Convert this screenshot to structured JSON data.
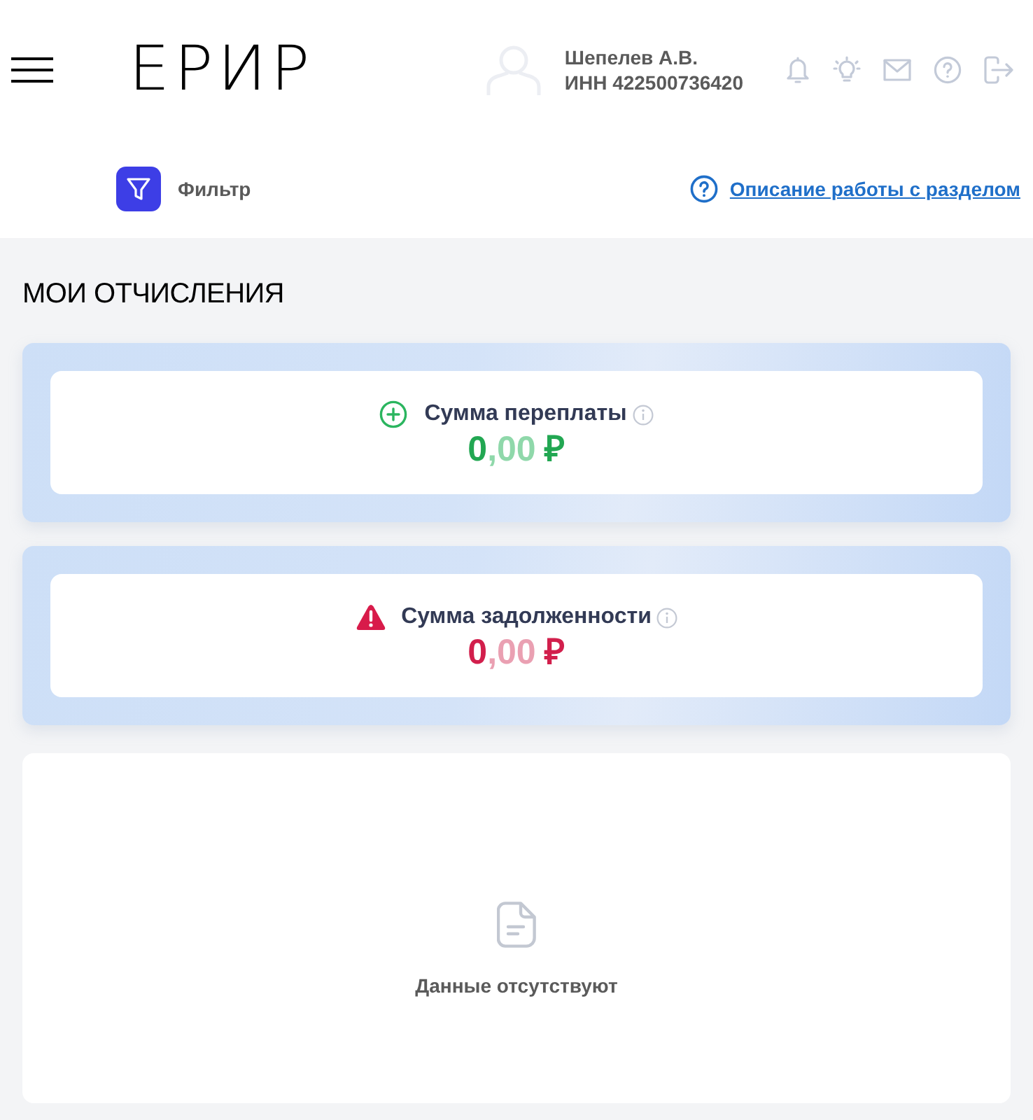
{
  "header": {
    "logo": "ЕРИР",
    "user": {
      "name": "Шепелев А.В.",
      "inn": "ИНН 422500736420"
    }
  },
  "toolbar": {
    "filter_label": "Фильтр",
    "help_link": "Описание работы с разделом"
  },
  "page_title": "МОИ ОТЧИСЛЕНИЯ",
  "balance_cards": [
    {
      "kind": "overpayment",
      "label": "Сумма переплаты",
      "amount_integer": "0",
      "amount_fraction": ",00",
      "currency": "₽"
    },
    {
      "kind": "debt",
      "label": "Сумма задолженности",
      "amount_integer": "0",
      "amount_fraction": ",00",
      "currency": "₽"
    }
  ],
  "empty_state": {
    "message": "Данные отсутствуют"
  }
}
